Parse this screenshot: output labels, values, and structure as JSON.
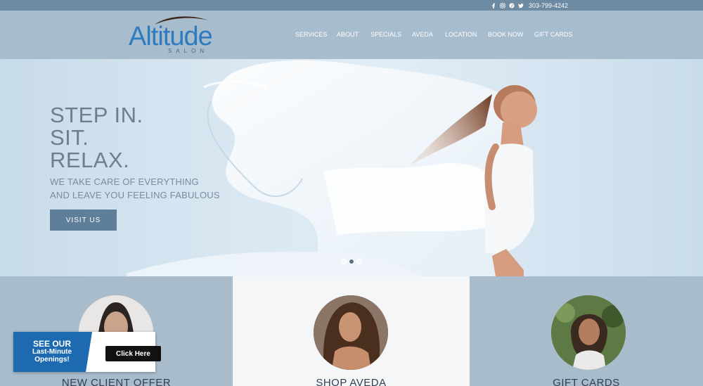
{
  "topbar": {
    "phone": "303-799-4242",
    "icons": [
      "facebook-icon",
      "instagram-icon",
      "pinterest-icon",
      "twitter-icon"
    ]
  },
  "logo": {
    "name": "Altitude",
    "subtitle": "SALON"
  },
  "nav": [
    {
      "label": "SERVICES"
    },
    {
      "label": "ABOUT"
    },
    {
      "label": "SPECIALS"
    },
    {
      "label": "AVEDA"
    },
    {
      "label": "LOCATION"
    },
    {
      "label": "BOOK NOW"
    },
    {
      "label": "GIFT CARDS"
    }
  ],
  "hero": {
    "headline": [
      "STEP IN.",
      "SIT.",
      "RELAX."
    ],
    "tagline": [
      "WE TAKE CARE OF EVERYTHING",
      "AND LEAVE YOU FEELING FABULOUS"
    ],
    "button": "VISIT US",
    "slides": 3,
    "active_slide": 2
  },
  "cards": [
    {
      "title": "NEW CLIENT OFFER"
    },
    {
      "title": "SHOP AVEDA"
    },
    {
      "title": "GIFT CARDS"
    }
  ],
  "popup": {
    "line1": "SEE OUR",
    "line2": "Last-Minute",
    "line3": "Openings!",
    "button": "Click Here"
  },
  "colors": {
    "topbar": "#6d8aa3",
    "header": "#a7bccd",
    "brand_blue": "#2e7bbf",
    "button": "#5f7e99",
    "popup_blue": "#1e6ab1"
  }
}
